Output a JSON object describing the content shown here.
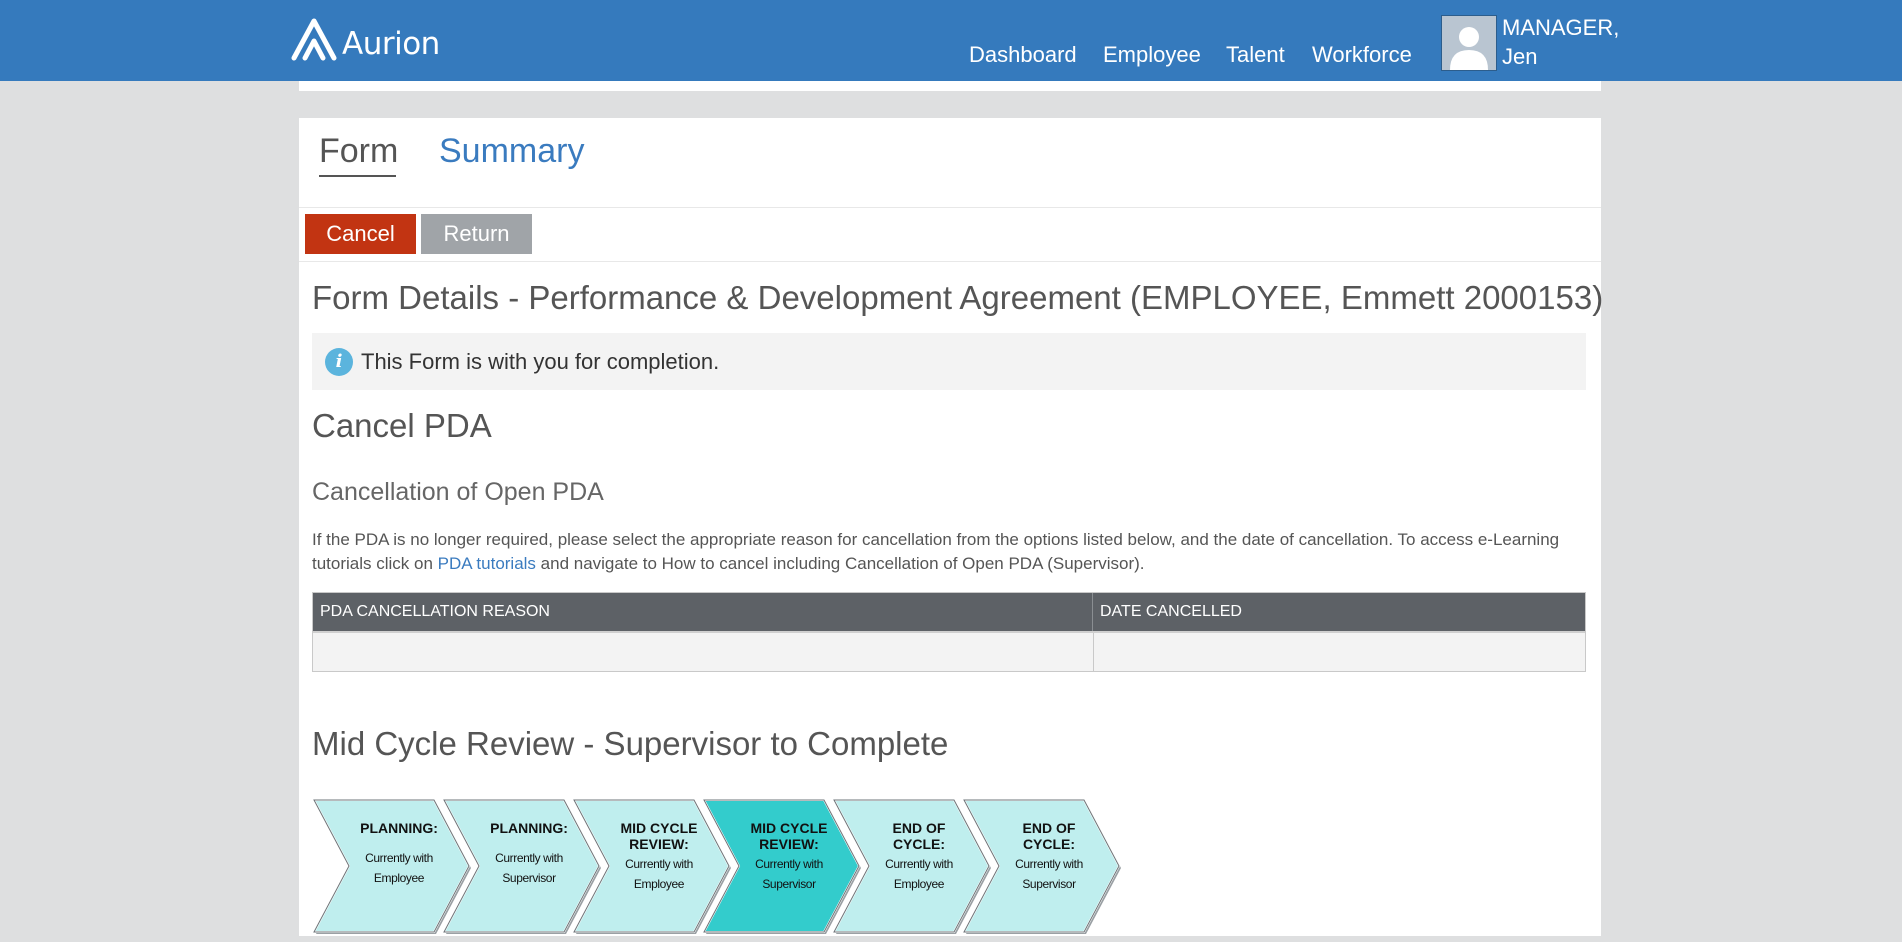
{
  "header": {
    "logo_text": "Aurion",
    "nav": [
      {
        "label": "Dashboard"
      },
      {
        "label": "Employee"
      },
      {
        "label": "Talent"
      },
      {
        "label": "Workforce"
      }
    ],
    "user": {
      "line1": "MANAGER,",
      "line2": "Jen"
    }
  },
  "tabs": {
    "form": "Form",
    "summary": "Summary"
  },
  "actions": {
    "cancel": "Cancel",
    "return": "Return"
  },
  "form": {
    "title": "Form Details - Performance & Development Agreement (EMPLOYEE, Emmett 2000153)",
    "info": "This Form is with you for completion.",
    "cancel_heading": "Cancel PDA",
    "cancel_subheading": "Cancellation of Open PDA",
    "paragraph": {
      "before_link": "If the PDA is no longer required, please select the appropriate reason for cancellation from the options listed below, and the date of cancellation. To access e-Learning tutorials click on ",
      "link": "PDA tutorials",
      "after_link": " and navigate to How to cancel including Cancellation of Open PDA (Supervisor)."
    },
    "table": {
      "columns": [
        "PDA CANCELLATION REASON",
        "DATE CANCELLED"
      ],
      "row": [
        "",
        ""
      ]
    },
    "mid_heading": "Mid Cycle Review - Supervisor to Complete"
  },
  "stages": [
    {
      "title1": "PLANNING:",
      "title2": "",
      "desc1": "Currently with",
      "desc2": "Employee",
      "active": false
    },
    {
      "title1": "PLANNING:",
      "title2": "",
      "desc1": "Currently with",
      "desc2": "Supervisor",
      "active": false
    },
    {
      "title1": "MID CYCLE",
      "title2": "REVIEW:",
      "desc1": "Currently with",
      "desc2": "Employee",
      "active": false
    },
    {
      "title1": "MID CYCLE",
      "title2": "REVIEW:",
      "desc1": "Currently with",
      "desc2": "Supervisor",
      "active": true
    },
    {
      "title1": "END OF",
      "title2": "CYCLE:",
      "desc1": "Currently with",
      "desc2": "Employee",
      "active": false
    },
    {
      "title1": "END OF",
      "title2": "CYCLE:",
      "desc1": "Currently with",
      "desc2": "Supervisor",
      "active": false
    }
  ],
  "colors": {
    "header_bg": "#357abd",
    "cancel_btn": "#c23412",
    "return_btn": "#a0a4a8",
    "stage_fill": "#bfeeee",
    "stage_active_fill": "#33cccc",
    "link": "#3a7bbf"
  },
  "icons": {
    "logo": "aurion-logo-icon",
    "avatar": "user-avatar-icon",
    "info": "info-icon"
  }
}
